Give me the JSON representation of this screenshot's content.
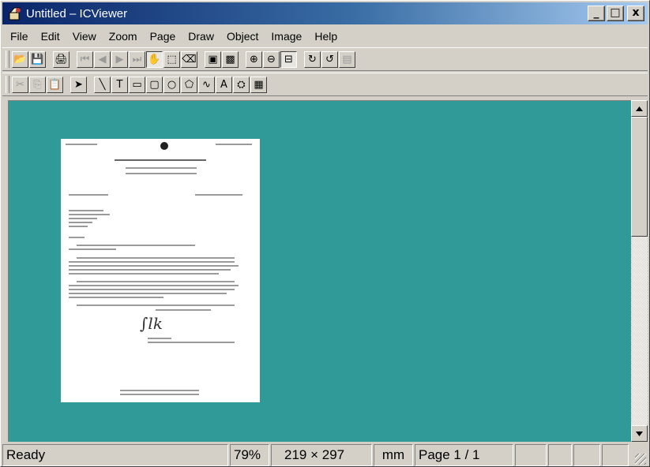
{
  "window": {
    "title": "Untitled – ICViewer",
    "minimize": "_",
    "maximize": "□",
    "close": "x"
  },
  "menu": [
    "File",
    "Edit",
    "View",
    "Zoom",
    "Page",
    "Draw",
    "Object",
    "Image",
    "Help"
  ],
  "toolbar1": [
    {
      "icon": "open-folder-icon",
      "glyph": "📂",
      "state": "raised"
    },
    {
      "icon": "save-icon",
      "glyph": "💾",
      "state": "raised"
    },
    {
      "sep": true
    },
    {
      "icon": "print-icon",
      "glyph": "🖨",
      "state": "raised"
    },
    {
      "sep": true
    },
    {
      "icon": "first-page-icon",
      "glyph": "⏮",
      "state": "disabled"
    },
    {
      "icon": "prev-page-icon",
      "glyph": "◀",
      "state": "disabled"
    },
    {
      "icon": "next-page-icon",
      "glyph": "▶",
      "state": "disabled"
    },
    {
      "icon": "last-page-icon",
      "glyph": "⏭",
      "state": "disabled"
    },
    {
      "icon": "hand-pan-icon",
      "glyph": "✋",
      "state": "pressed"
    },
    {
      "icon": "select-rect-icon",
      "glyph": "⬚",
      "state": "raised"
    },
    {
      "icon": "eraser-icon",
      "glyph": "⌫",
      "state": "raised"
    },
    {
      "sep": true
    },
    {
      "icon": "fit-page-icon",
      "glyph": "▣",
      "state": "raised"
    },
    {
      "icon": "fit-image-icon",
      "glyph": "▩",
      "state": "raised"
    },
    {
      "sep": true
    },
    {
      "icon": "zoom-in-icon",
      "glyph": "⊕",
      "state": "raised"
    },
    {
      "icon": "zoom-out-icon",
      "glyph": "⊖",
      "state": "raised"
    },
    {
      "icon": "fit-width-icon",
      "glyph": "⊟",
      "state": "pressed"
    },
    {
      "sep": true
    },
    {
      "icon": "rotate-right-icon",
      "glyph": "↻",
      "state": "raised"
    },
    {
      "icon": "rotate-left-icon",
      "glyph": "↺",
      "state": "raised"
    },
    {
      "icon": "properties-icon",
      "glyph": "▤",
      "state": "disabled"
    }
  ],
  "toolbar2": [
    {
      "icon": "cut-icon",
      "glyph": "✂",
      "state": "disabled"
    },
    {
      "icon": "copy-icon",
      "glyph": "⎘",
      "state": "disabled"
    },
    {
      "icon": "paste-icon",
      "glyph": "📋",
      "state": "raised"
    },
    {
      "sep": true
    },
    {
      "icon": "pointer-icon",
      "glyph": "➤",
      "state": "raised"
    },
    {
      "sep": true
    },
    {
      "icon": "line-tool-icon",
      "glyph": "╲",
      "state": "raised"
    },
    {
      "icon": "text-tool-icon",
      "glyph": "T",
      "state": "raised"
    },
    {
      "icon": "rectangle-tool-icon",
      "glyph": "▭",
      "state": "raised"
    },
    {
      "icon": "rounded-rect-tool-icon",
      "glyph": "▢",
      "state": "raised"
    },
    {
      "icon": "ellipse-tool-icon",
      "glyph": "○",
      "state": "raised"
    },
    {
      "icon": "polygon-tool-icon",
      "glyph": "⬠",
      "state": "raised"
    },
    {
      "icon": "freehand-tool-icon",
      "glyph": "∿",
      "state": "raised"
    },
    {
      "icon": "font-tool-icon",
      "glyph": "A",
      "state": "raised"
    },
    {
      "icon": "stamp-tool-icon",
      "glyph": "⛭",
      "state": "raised"
    },
    {
      "icon": "image-tool-icon",
      "glyph": "▦",
      "state": "raised"
    }
  ],
  "status": {
    "text": "Ready",
    "zoom": "79%",
    "size": "219 × 297",
    "unit": "mm",
    "page": "Page  1  /  1"
  },
  "colors": {
    "workspace": "#2f9a97",
    "chrome": "#d4d0c8",
    "titlebar_start": "#0a246a",
    "titlebar_end": "#a6caf0"
  }
}
